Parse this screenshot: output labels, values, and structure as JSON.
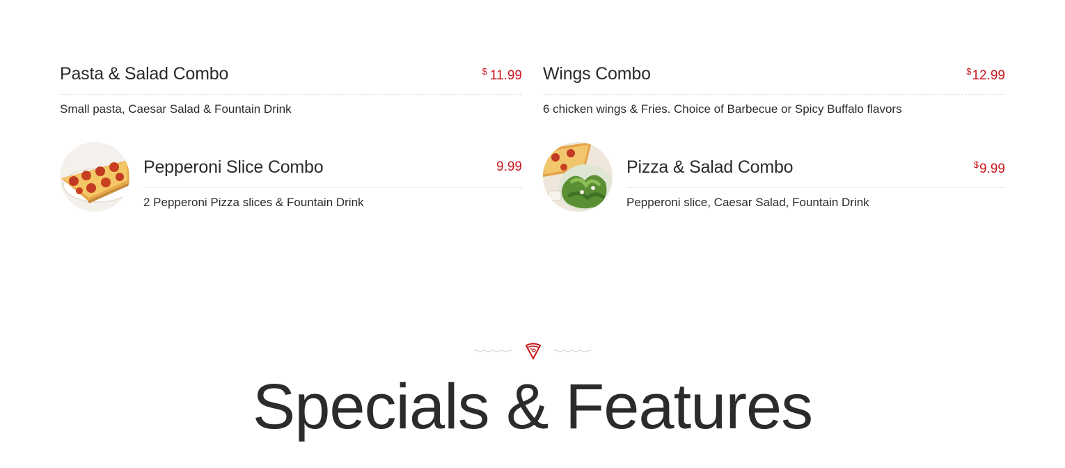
{
  "menu_items": [
    {
      "name": "Pasta & Salad Combo",
      "currency": "$",
      "price": "11.99",
      "description": "Small pasta, Caesar Salad & Fountain Drink"
    },
    {
      "name": "Wings Combo",
      "currency": "$",
      "price": "12.99",
      "description": "6 chicken wings & Fries. Choice of Barbecue or Spicy Buffalo flavors"
    },
    {
      "name": "Pepperoni Slice Combo",
      "price": "9.99",
      "description": "2 Pepperoni Pizza slices & Fountain Drink",
      "image_icon": "pepperoni-pizza-slice"
    },
    {
      "name": "Pizza & Salad Combo",
      "currency": "$",
      "price": "9.99",
      "description": "Pepperoni slice, Caesar Salad, Fountain Drink",
      "image_icon": "pizza-and-salad"
    }
  ],
  "specials_section": {
    "divider_icon": "pizza-slice-icon",
    "title": "Specials & Features"
  },
  "colors": {
    "accent": "#c8151b",
    "text": "#2b2b2b",
    "rule": "#e3e3e3"
  }
}
